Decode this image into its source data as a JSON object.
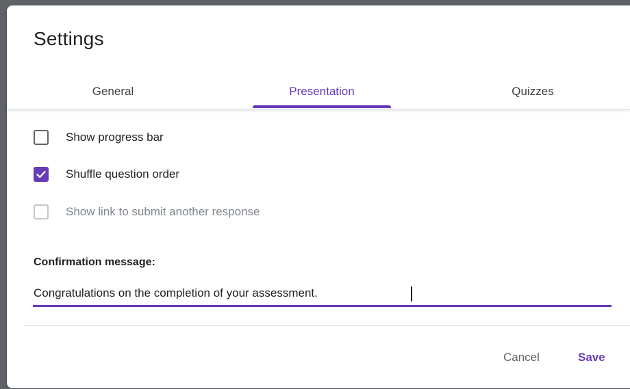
{
  "dialog": {
    "title": "Settings"
  },
  "tabs": [
    {
      "label": "General",
      "active": false
    },
    {
      "label": "Presentation",
      "active": true
    },
    {
      "label": "Quizzes",
      "active": false
    }
  ],
  "options": [
    {
      "label": "Show progress bar",
      "checked": false,
      "disabled": false
    },
    {
      "label": "Shuffle question order",
      "checked": true,
      "disabled": false
    },
    {
      "label": "Show link to submit another response",
      "checked": false,
      "disabled": true
    }
  ],
  "confirmation": {
    "label": "Confirmation message:",
    "value": "Congratulations on the completion of your assessment."
  },
  "actions": {
    "cancel_label": "Cancel",
    "save_label": "Save"
  },
  "colors": {
    "accent": "#673ab7",
    "text": "#202124",
    "muted": "#80868b"
  }
}
